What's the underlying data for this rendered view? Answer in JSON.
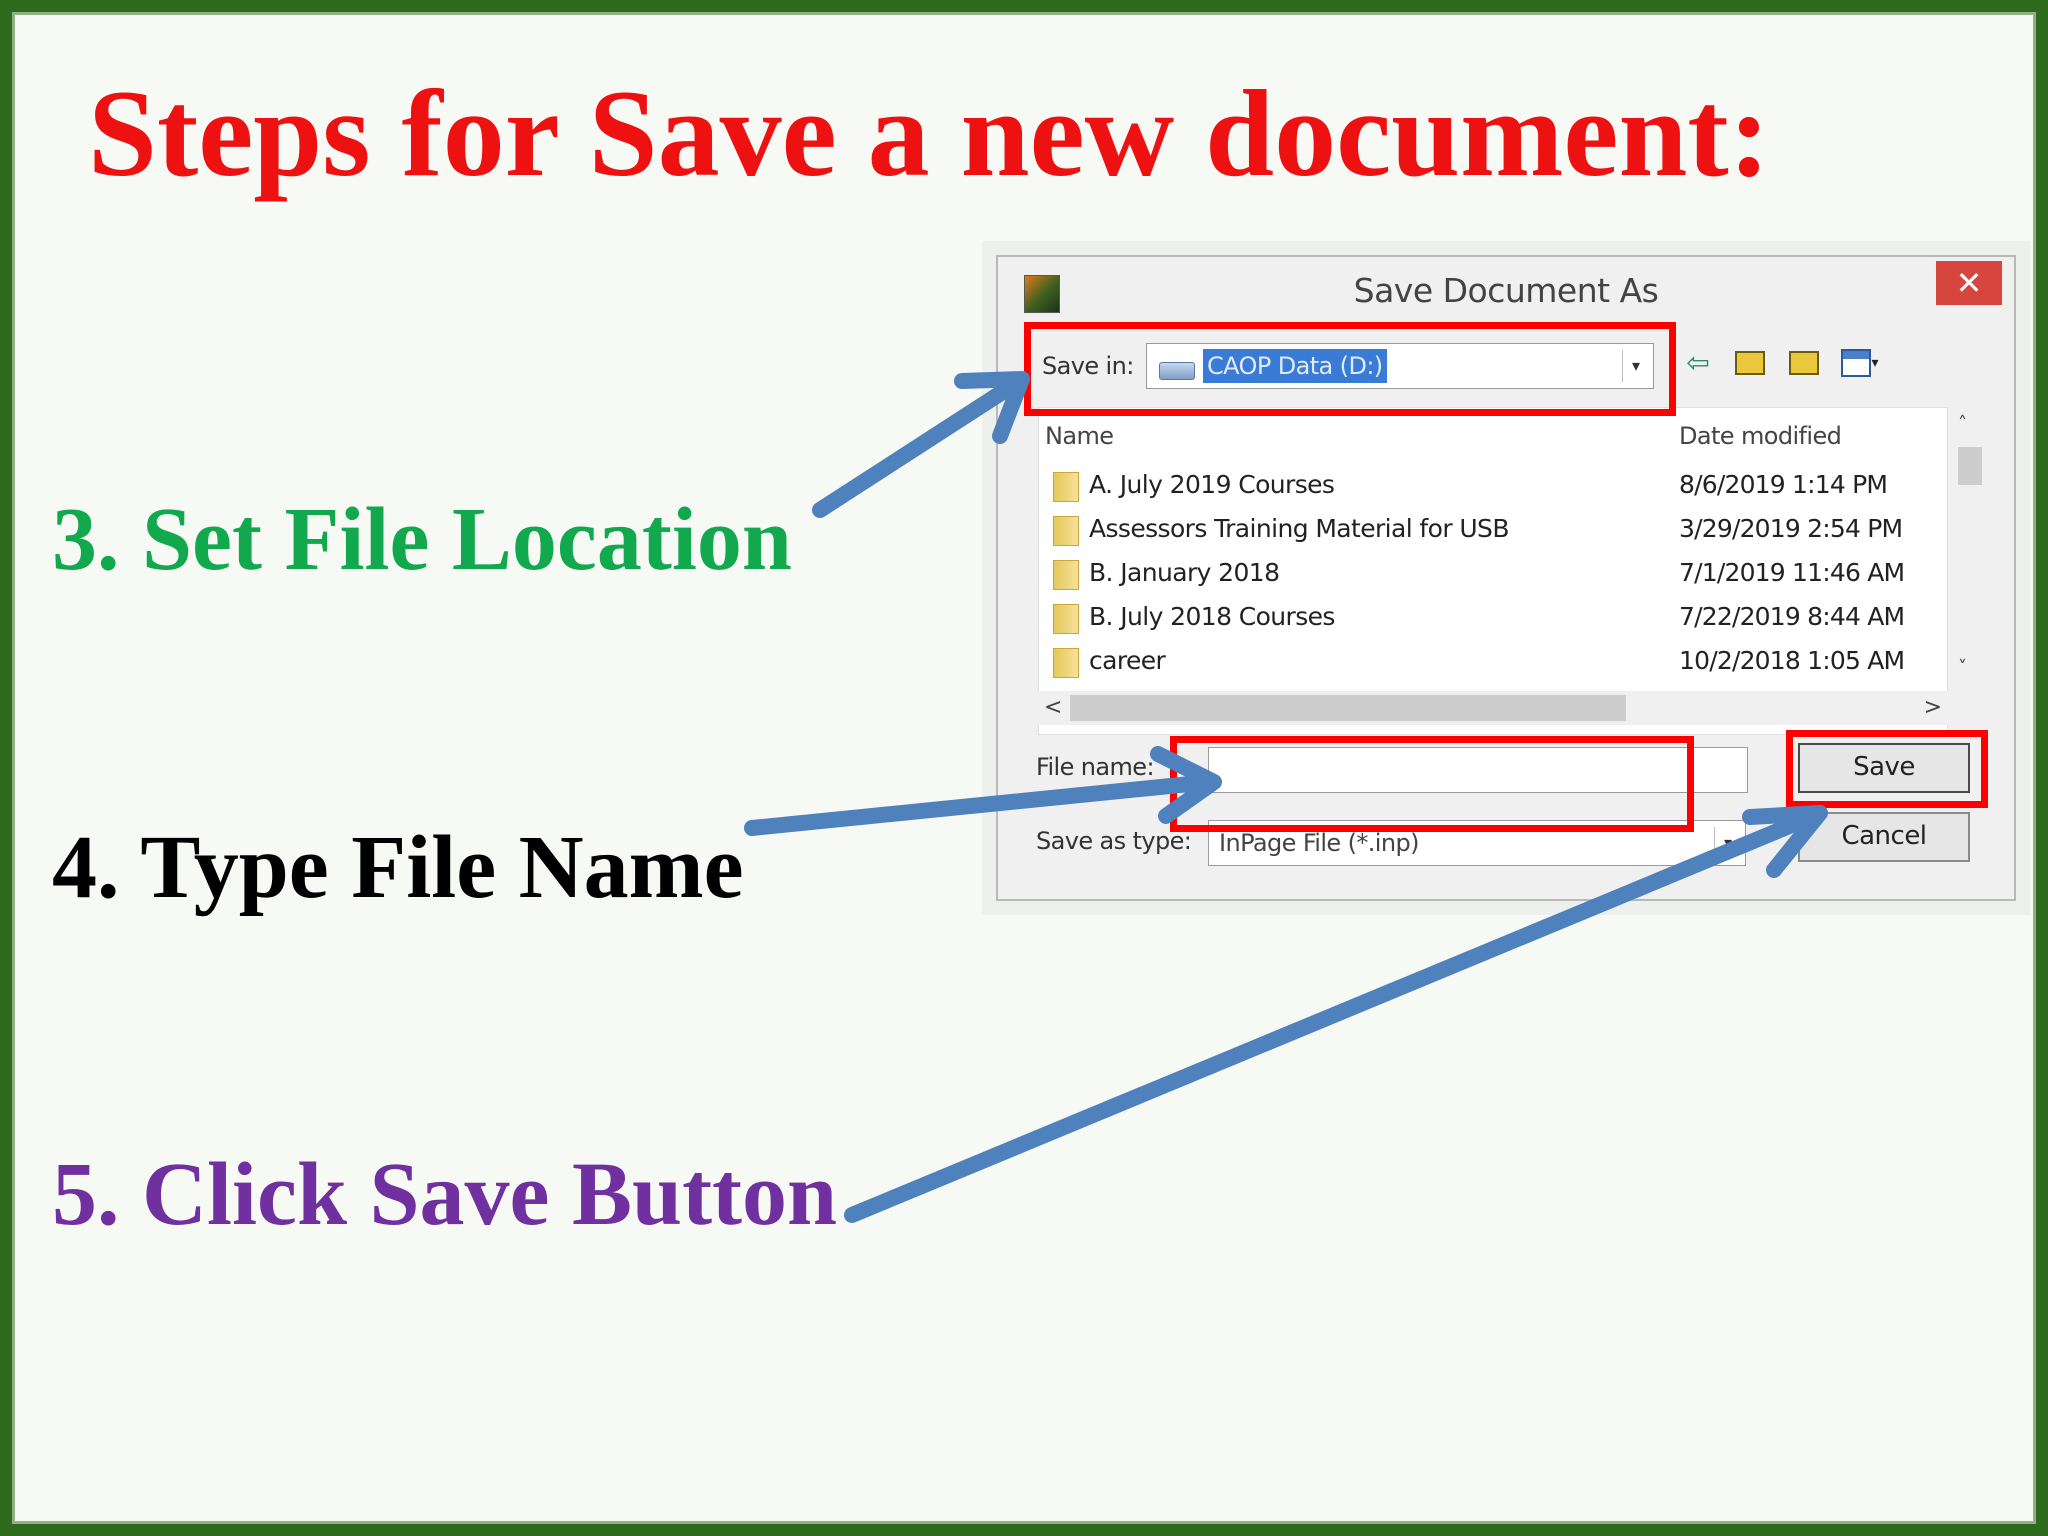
{
  "slide": {
    "title": "Steps for Save a new document:",
    "title_color": "#ee1111",
    "steps": [
      {
        "text": "3. Set File Location",
        "color": "#12a84e"
      },
      {
        "text": "4. Type File Name",
        "color": "#000000"
      },
      {
        "text": "5. Click Save Button",
        "color": "#7030a0"
      }
    ],
    "highlight_color": "#ff0000",
    "arrow_color": "#4f81bd"
  },
  "dialog": {
    "title": "Save Document As",
    "close_glyph": "✕",
    "save_in_label": "Save in:",
    "save_in_value": "CAOP Data (D:)",
    "combo_arrow": "▾",
    "columns": {
      "name": "Name",
      "date": "Date modified"
    },
    "files": [
      {
        "name": "A. July 2019 Courses",
        "date": "8/6/2019 1:14 PM"
      },
      {
        "name": "Assessors Training Material for USB",
        "date": "3/29/2019 2:54 PM"
      },
      {
        "name": "B. January 2018",
        "date": "7/1/2019 11:46 AM"
      },
      {
        "name": "B. July 2018 Courses",
        "date": "7/22/2019 8:44 AM"
      },
      {
        "name": "career",
        "date": "10/2/2018 1:05 AM"
      }
    ],
    "scroll": {
      "up": "˄",
      "down": "˅",
      "left": "<",
      "right": ">"
    },
    "file_name_label": "File name:",
    "file_name_value": "",
    "save_type_label": "Save as type:",
    "save_type_value": "InPage File (*.inp)",
    "save_button": "Save",
    "cancel_button": "Cancel",
    "icons": {
      "back": "back-arrow-icon",
      "up": "up-folder-icon",
      "new_folder": "new-folder-icon",
      "view": "view-menu-icon"
    }
  }
}
